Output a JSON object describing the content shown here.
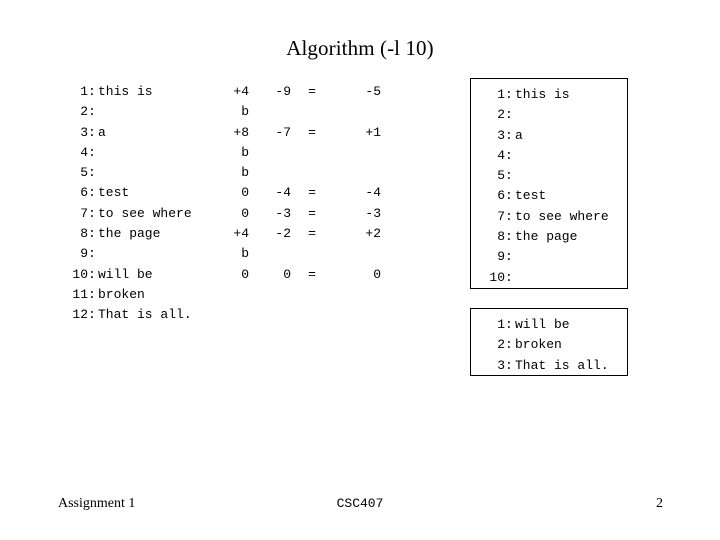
{
  "slide": {
    "title": "Algorithm (-l 10)",
    "background_color": "#ffffff",
    "text_color": "#000000"
  },
  "left_listing": {
    "rows": [
      {
        "lineno": "1",
        "colon": ":",
        "text": "this is",
        "n1": "+4",
        "n2": "-9",
        "eq": "=",
        "n3": "-5"
      },
      {
        "lineno": "2",
        "colon": ":",
        "text": "",
        "n1": "b",
        "n2": "",
        "eq": "",
        "n3": ""
      },
      {
        "lineno": "3",
        "colon": ":",
        "text": "a",
        "n1": "+8",
        "n2": "-7",
        "eq": "=",
        "n3": "+1"
      },
      {
        "lineno": "4",
        "colon": ":",
        "text": "",
        "n1": "b",
        "n2": "",
        "eq": "",
        "n3": ""
      },
      {
        "lineno": "5",
        "colon": ":",
        "text": "",
        "n1": "b",
        "n2": "",
        "eq": "",
        "n3": ""
      },
      {
        "lineno": "6",
        "colon": ":",
        "text": "test",
        "n1": "0",
        "n2": "-4",
        "eq": "=",
        "n3": "-4"
      },
      {
        "lineno": "7",
        "colon": ":",
        "text": "to see where",
        "n1": "0",
        "n2": "-3",
        "eq": "=",
        "n3": "-3"
      },
      {
        "lineno": "8",
        "colon": ":",
        "text": "the page",
        "n1": "+4",
        "n2": "-2",
        "eq": "=",
        "n3": "+2"
      },
      {
        "lineno": "9",
        "colon": ":",
        "text": "",
        "n1": "b",
        "n2": "",
        "eq": "",
        "n3": ""
      },
      {
        "lineno": "10",
        "colon": ":",
        "text": "will be",
        "n1": "0",
        "n2": "0",
        "eq": "=",
        "n3": "0"
      },
      {
        "lineno": "11",
        "colon": ":",
        "text": "broken",
        "n1": "",
        "n2": "",
        "eq": "",
        "n3": ""
      },
      {
        "lineno": "12",
        "colon": ":",
        "text": "That is all.",
        "n1": "",
        "n2": "",
        "eq": "",
        "n3": ""
      }
    ]
  },
  "page_boxes": [
    {
      "rows": [
        {
          "lineno": "1",
          "colon": ":",
          "text": "this is"
        },
        {
          "lineno": "2",
          "colon": ":",
          "text": ""
        },
        {
          "lineno": "3",
          "colon": ":",
          "text": "a"
        },
        {
          "lineno": "4",
          "colon": ":",
          "text": ""
        },
        {
          "lineno": "5",
          "colon": ":",
          "text": ""
        },
        {
          "lineno": "6",
          "colon": ":",
          "text": "test"
        },
        {
          "lineno": "7",
          "colon": ":",
          "text": "to see where"
        },
        {
          "lineno": "8",
          "colon": ":",
          "text": "the page"
        },
        {
          "lineno": "9",
          "colon": ":",
          "text": ""
        },
        {
          "lineno": "10",
          "colon": ":",
          "text": ""
        }
      ]
    },
    {
      "rows": [
        {
          "lineno": "1",
          "colon": ":",
          "text": "will be"
        },
        {
          "lineno": "2",
          "colon": ":",
          "text": "broken"
        },
        {
          "lineno": "3",
          "colon": ":",
          "text": "That is all."
        }
      ]
    }
  ],
  "footer": {
    "left": "Assignment 1",
    "center": "CSC407",
    "right": "2"
  }
}
